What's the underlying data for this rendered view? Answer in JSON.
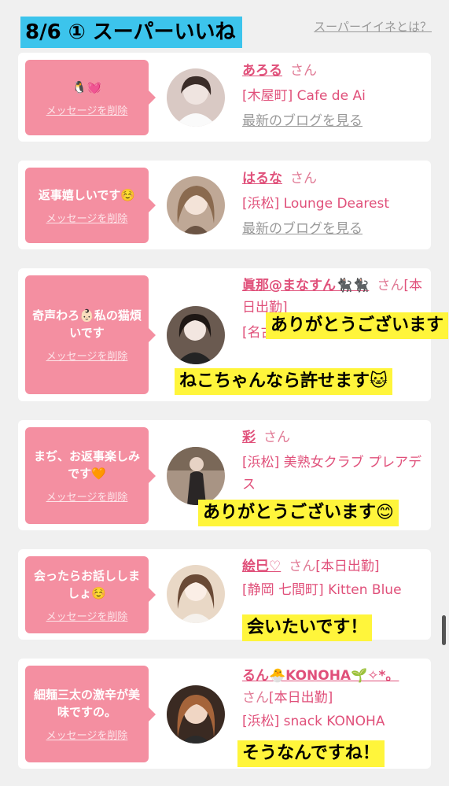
{
  "header": {
    "title": "8/6 ① スーパーいいね",
    "help_link": "スーパーイイネとは？"
  },
  "entries": [
    {
      "message": "🐧💓",
      "delete_label": "メッセージを削除",
      "name": "あろる",
      "honorific": "さん",
      "attendance": "",
      "shop": "[木屋町] Cafe de Ai",
      "blog_link": "最新のブログを見る",
      "reply": ""
    },
    {
      "message": "返事嬉しいです☺️",
      "delete_label": "メッセージを削除",
      "name": "はるな",
      "honorific": "さん",
      "attendance": "",
      "shop": "[浜松] Lounge Dearest",
      "blog_link": "最新のブログを見る",
      "reply": ""
    },
    {
      "message": "奇声わろ👶🏻私の猫煩いです",
      "delete_label": "メッセージを削除",
      "name": "眞那@まなすん🐈‍⬛🐈‍⬛",
      "honorific": "さん",
      "attendance": "[本日出勤]",
      "shop": "[名古屋] ANEMONE",
      "blog_link": "",
      "reply": "ありがとうございます",
      "reply2": "ねこちゃんなら許せます🐱"
    },
    {
      "message": "まぢ、お返事楽しみです🧡",
      "delete_label": "メッセージを削除",
      "name": "彩",
      "honorific": "さん",
      "attendance": "",
      "shop": "[浜松] 美熟女クラブ プレアデス",
      "blog_link": "",
      "reply": "ありがとうございます😊"
    },
    {
      "message": "会ったらお話ししましょ☺️",
      "delete_label": "メッセージを削除",
      "name": "絵巳♡",
      "honorific": "さん",
      "attendance": "[本日出勤]",
      "shop": "[静岡 七間町] Kitten Blue",
      "blog_link": "",
      "reply": "会いたいです！"
    },
    {
      "message": "細麺三太の激辛が美味ですの。",
      "delete_label": "メッセージを削除",
      "name": "るん🐣KONOHA🌱✧*。",
      "honorific": "さん",
      "attendance": "[本日出勤]",
      "shop": "[浜松] snack KONOHA",
      "blog_link": "",
      "reply": "そうなんですね！"
    }
  ]
}
